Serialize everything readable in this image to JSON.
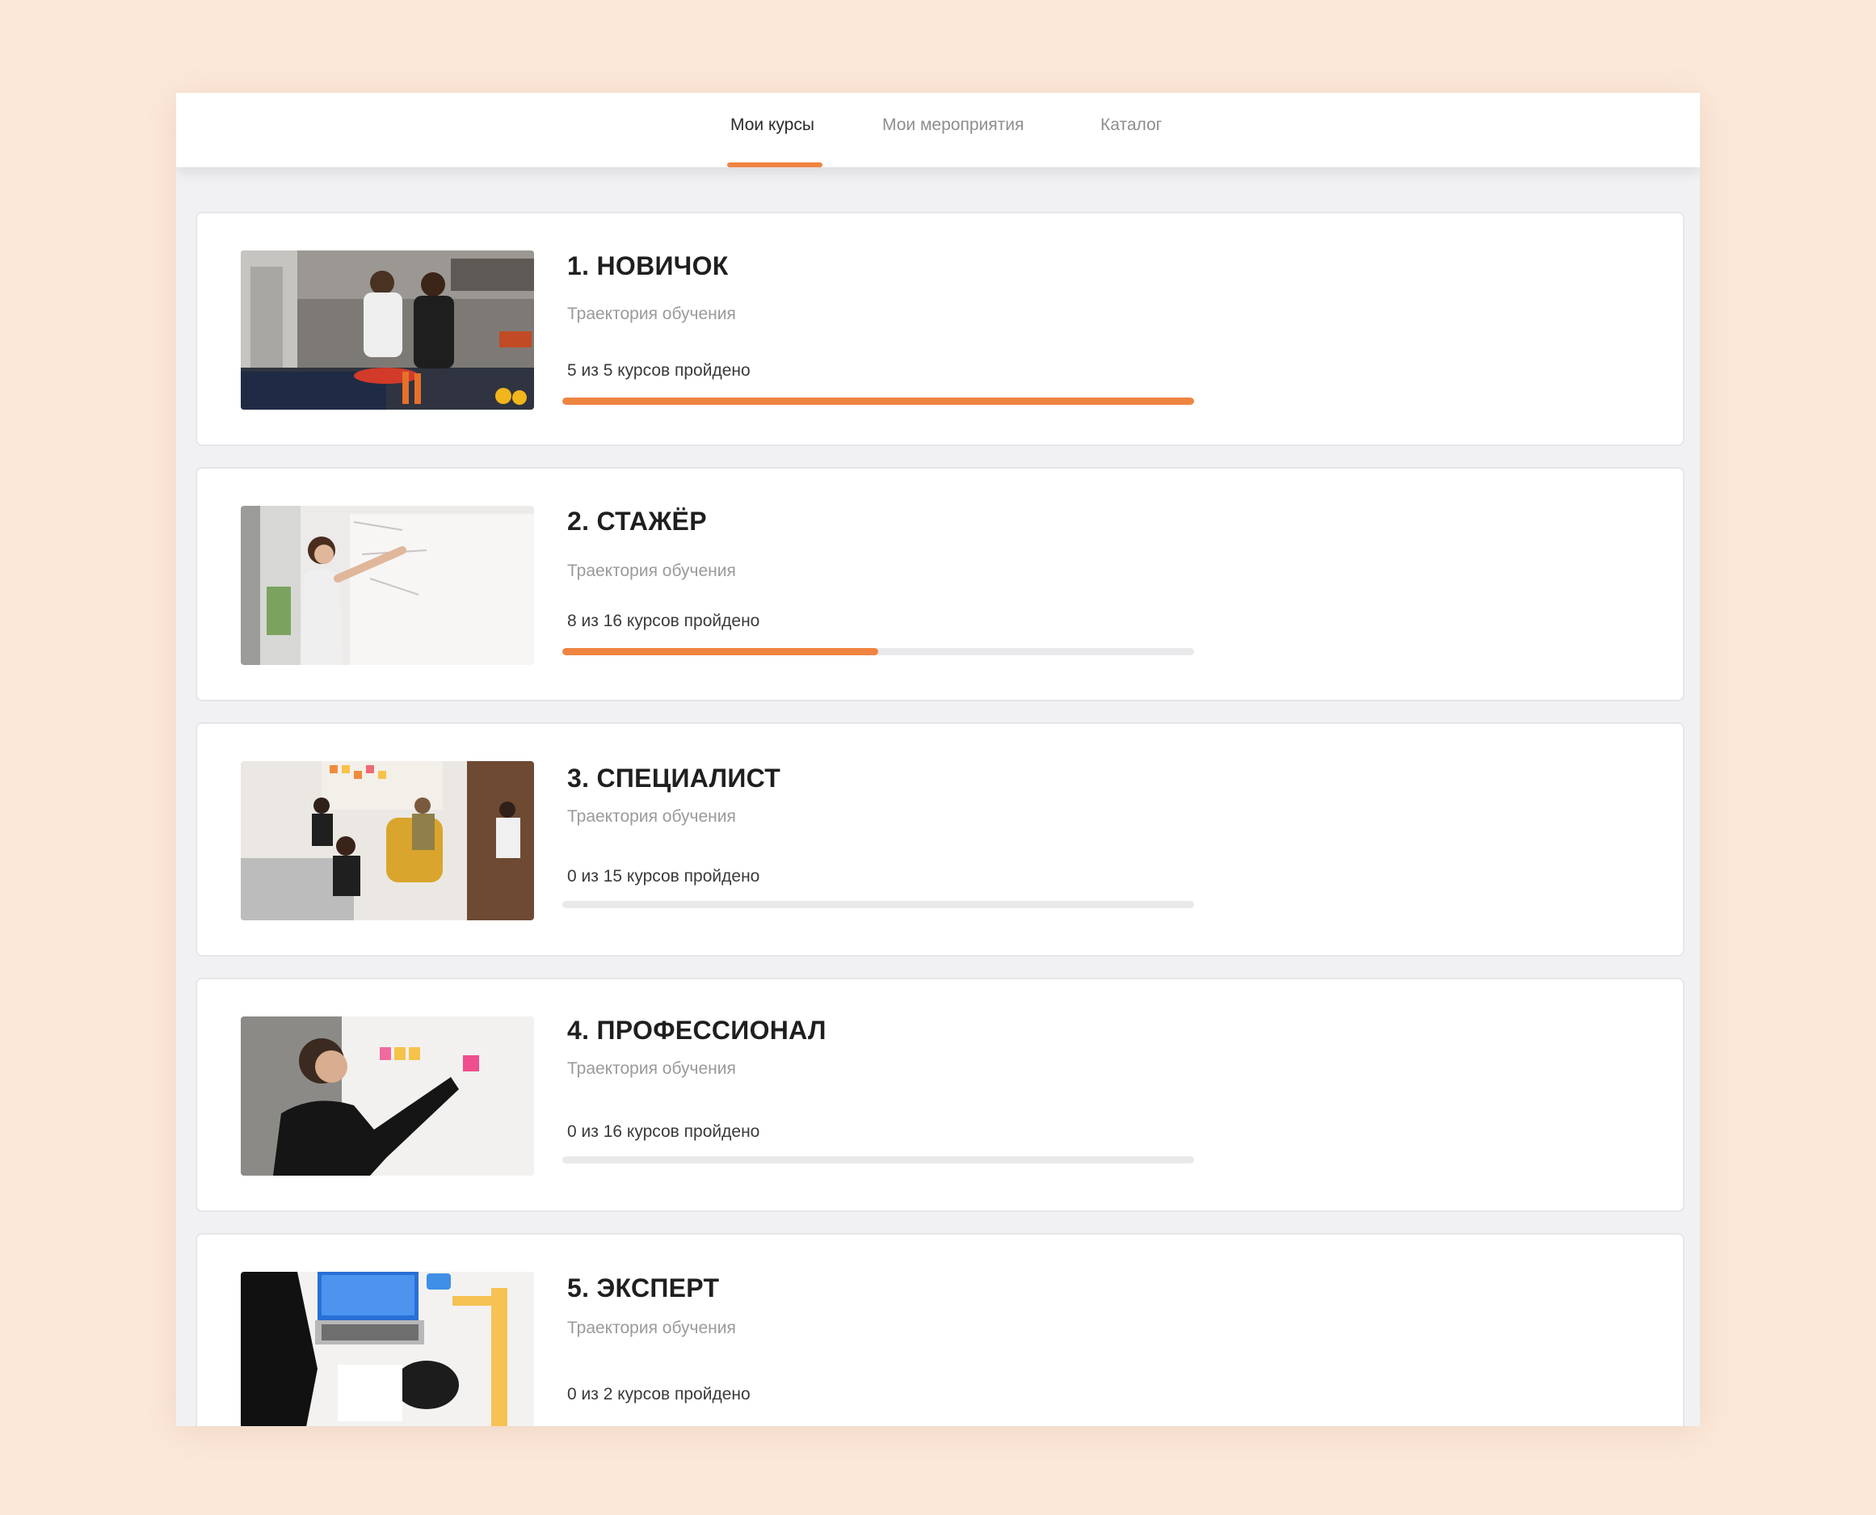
{
  "colors": {
    "accent": "#ef8441",
    "background": "#fce8d9"
  },
  "tabs": [
    {
      "label": "Мои курсы",
      "active": true
    },
    {
      "label": "Мои мероприятия",
      "active": false
    },
    {
      "label": "Каталог",
      "active": false
    }
  ],
  "courses": [
    {
      "title": "1. НОВИЧОК",
      "subtitle": "Траектория обучения",
      "progress_text": "5 из 5 курсов пройдено",
      "completed": 5,
      "total": 5,
      "progress": 1.0,
      "image": "kitchen-photo"
    },
    {
      "title": "2. СТАЖЁР",
      "subtitle": "Траектория обучения",
      "progress_text": "8 из 16 курсов пройдено",
      "completed": 8,
      "total": 16,
      "progress": 0.5,
      "image": "whiteboard-photo"
    },
    {
      "title": "3. СПЕЦИАЛИСТ",
      "subtitle": "Траектория обучения",
      "progress_text": "0 из 15 курсов пройдено",
      "completed": 0,
      "total": 15,
      "progress": 0,
      "image": "team-meeting-photo"
    },
    {
      "title": "4. ПРОФЕССИОНАЛ",
      "subtitle": "Траектория обучения",
      "progress_text": "0 из 16 курсов пройдено",
      "completed": 0,
      "total": 16,
      "progress": 0,
      "image": "sticky-notes-photo"
    },
    {
      "title": "5. ЭКСПЕРТ",
      "subtitle": "Траектория обучения",
      "progress_text": "0 из 2 курсов пройдено",
      "completed": 0,
      "total": 2,
      "progress": 0,
      "image": "laptop-desk-photo"
    }
  ]
}
